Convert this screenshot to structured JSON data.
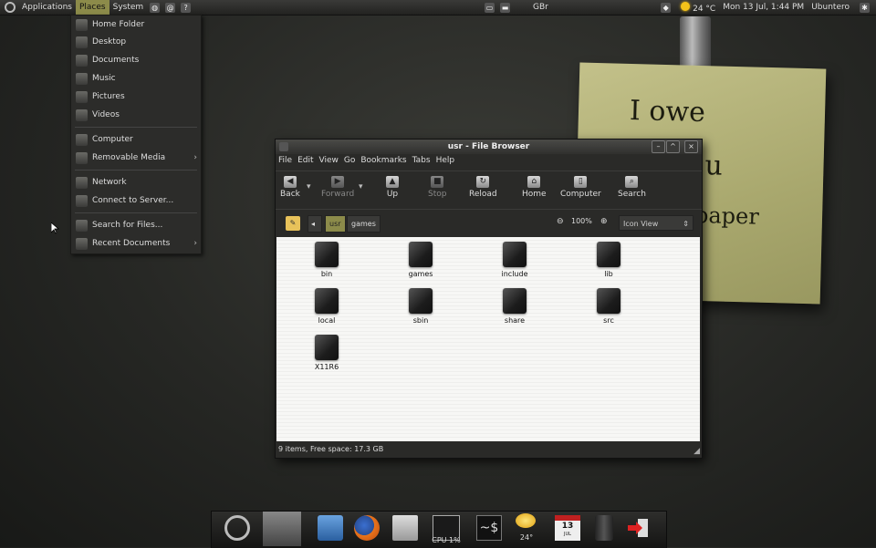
{
  "top_panel": {
    "menus": [
      "Applications",
      "Places",
      "System"
    ],
    "center_label": "GBr",
    "weather": "24 °C",
    "clock": "Mon 13 Jul,  1:44 PM",
    "user": "Ubuntero"
  },
  "places_menu": {
    "items": [
      "Home Folder",
      "Desktop",
      "Documents",
      "Music",
      "Pictures",
      "Videos",
      "Computer",
      "Removable Media",
      "Network",
      "Connect to Server...",
      "Search for Files...",
      "Recent Documents"
    ]
  },
  "note": {
    "line1": "I owe",
    "line2": "u",
    "line3": "paper"
  },
  "window": {
    "title": "usr - File Browser",
    "menu": [
      "File",
      "Edit",
      "View",
      "Go",
      "Bookmarks",
      "Tabs",
      "Help"
    ],
    "toolbar": {
      "back": "Back",
      "forward": "Forward",
      "up": "Up",
      "stop": "Stop",
      "reload": "Reload",
      "home": "Home",
      "computer": "Computer",
      "search": "Search"
    },
    "path": [
      "usr",
      "games"
    ],
    "zoom": "100%",
    "view_mode": "Icon View",
    "files": [
      "bin",
      "games",
      "include",
      "lib",
      "local",
      "sbin",
      "share",
      "src",
      "X11R6"
    ],
    "status": "9 items, Free space: 17.3 GB"
  },
  "dock": {
    "cpu_label": "CPU 1%",
    "weather_label": "24°",
    "calendar_day": "13",
    "calendar_month": "JUL",
    "terminal_label": "~$"
  }
}
